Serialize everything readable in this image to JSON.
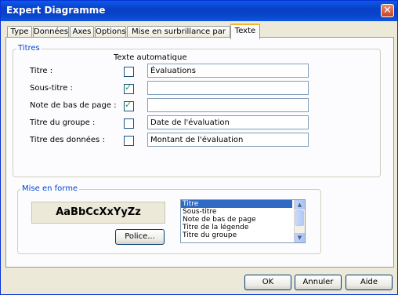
{
  "window": {
    "title": "Expert Diagramme",
    "close_glyph": "✕"
  },
  "tabs": [
    {
      "label": "Type"
    },
    {
      "label": "Données"
    },
    {
      "label": "Axes"
    },
    {
      "label": "Options"
    },
    {
      "label": "Mise en surbrillance par la couleur"
    },
    {
      "label": "Texte",
      "active": true
    }
  ],
  "titres": {
    "group_label": "Titres",
    "auto_header": "Texte automatique",
    "rows": [
      {
        "label": "Titre :",
        "checked": false,
        "value": "Évaluations"
      },
      {
        "label": "Sous-titre :",
        "checked": true,
        "value": ""
      },
      {
        "label": "Note de bas de page :",
        "checked": true,
        "value": ""
      },
      {
        "label": "Titre du groupe :",
        "checked": false,
        "value": "Date de l'évaluation"
      },
      {
        "label": "Titre des données :",
        "checked": false,
        "value": "Montant de l'évaluation"
      }
    ]
  },
  "format": {
    "group_label": "Mise en forme",
    "sample_text": "AaBbCcXxYyZz",
    "font_button": "Police...",
    "list_items": [
      "Titre",
      "Sous-titre",
      "Note de bas de page",
      "Titre de la légende",
      "Titre du groupe"
    ],
    "selected": "Titre"
  },
  "buttons": {
    "ok": "OK",
    "cancel": "Annuler",
    "help": "Aide"
  },
  "colors": {
    "accent": "#0a3fc7",
    "selection": "#316ac5",
    "check": "#21a121"
  }
}
